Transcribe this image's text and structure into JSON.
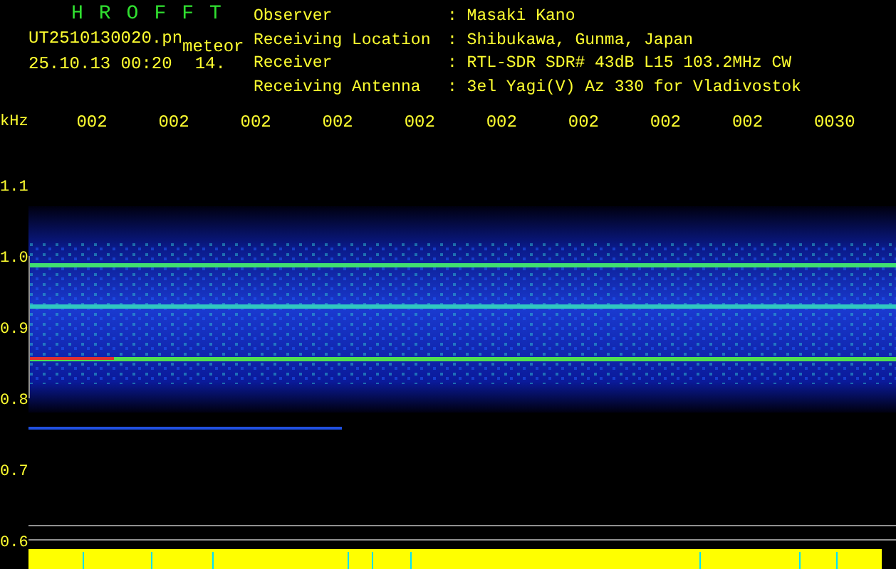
{
  "app_title": "HROFFT",
  "file": {
    "name": "UT2510130020.pn",
    "suffix": "meteor",
    "datetime": "25.10.13 00:20",
    "value": "14."
  },
  "info": [
    {
      "label": "Observer",
      "value": ": Masaki Kano"
    },
    {
      "label": "Receiving Location",
      "value": ": Shibukawa, Gunma, Japan"
    },
    {
      "label": "Receiver",
      "value": ": RTL-SDR SDR# 43dB L15 103.2MHz CW"
    },
    {
      "label": "Receiving Antenna",
      "value": ": 3el Yagi(V) Az 330 for Vladivostok"
    }
  ],
  "y_unit": "kHz",
  "time_labels": [
    "002",
    "002",
    "002",
    "002",
    "002",
    "002",
    "002",
    "002",
    "002",
    "0030"
  ],
  "y_labels": [
    "1.1",
    "1.0",
    "0.9",
    "0.8",
    "0.7",
    "0.6"
  ]
}
